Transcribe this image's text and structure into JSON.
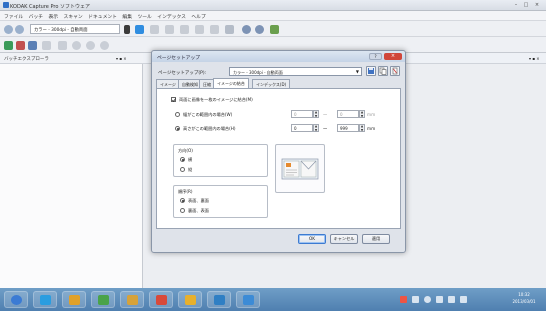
{
  "app": {
    "title": "KODAK Capture Pro ソフトウェア",
    "window_controls": [
      "–",
      "□",
      "×"
    ]
  },
  "menu": [
    "ファイル",
    "バッチ",
    "表示",
    "スキャン",
    "ドキュメント",
    "編集",
    "ツール",
    "インデックス",
    "ヘルプ"
  ],
  "toolbar": {
    "setting_combo": "カラー - 300dpi - 自動両面"
  },
  "explorer": {
    "title": "バッチエクスプローラ",
    "controls": "▾ ▪ ×"
  },
  "main_header": {
    "controls": "▾ ▪ ×"
  },
  "dialog": {
    "title": "ページセットアップ",
    "close": "×",
    "help": "?",
    "setup_label": "ページセットアップ(P):",
    "setup_value": "カラー - 300dpi - 自動両面",
    "tabs": [
      "イメージ",
      "自動検知",
      "圧縮",
      "イメージの結合",
      "インデックス(D)"
    ],
    "active_tab": "イメージの結合",
    "merge_checkbox": "両面に画像を一枚のイメージに結合(M)",
    "option_width_range": "幅がこの範囲内の場合(W)",
    "option_height_range": "高さがこの範囲内の場合(H)",
    "width_from": "0",
    "width_to": "0",
    "width_unit": "mm",
    "height_from": "0",
    "height_to": "999",
    "height_unit": "mm",
    "range_sep": "〜",
    "direction": {
      "title": "方向(O)",
      "opt1": "横",
      "opt2": "縦"
    },
    "order": {
      "title": "順序(R)",
      "opt1": "表面、裏面",
      "opt2": "裏面、表面"
    },
    "buttons": {
      "ok": "OK",
      "cancel": "キャンセル",
      "apply": "適用"
    }
  },
  "taskbar": {
    "clock_time": "10:32",
    "clock_date": "2013/03/01"
  },
  "colors": {
    "taskbar": "#5a88b8",
    "dialog_bg": "#dfe3ea",
    "close_red": "#d0463a"
  }
}
